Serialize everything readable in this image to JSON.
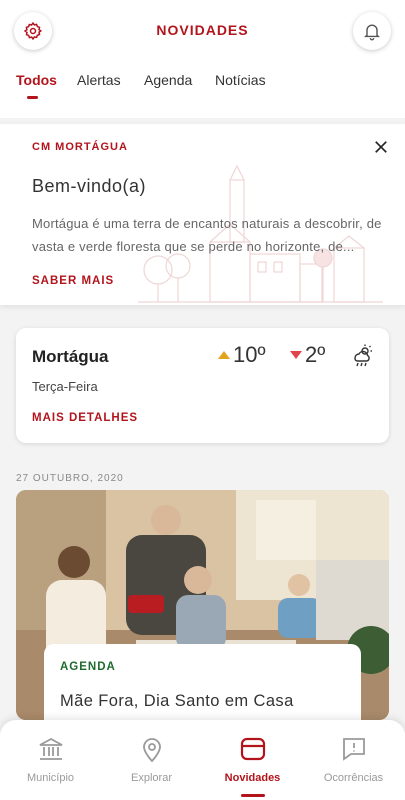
{
  "header": {
    "title": "NOVIDADES",
    "settings_icon": "gear-icon",
    "notifications_icon": "bell-icon"
  },
  "tabs": [
    {
      "label": "Todos",
      "active": true
    },
    {
      "label": "Alertas",
      "active": false
    },
    {
      "label": "Agenda",
      "active": false
    },
    {
      "label": "Notícias",
      "active": false
    }
  ],
  "welcome": {
    "source": "CM MORTÁGUA",
    "title": "Bem-vindo(a)",
    "text": "Mortágua é uma terra de encantos naturais a descobrir, de vasta e verde floresta que se perde no horizonte, de...",
    "link": "SABER MAIS"
  },
  "weather": {
    "city": "Mortágua",
    "day": "Terça-Feira",
    "max": "10º",
    "min": "2º",
    "icon": "rain-sun-icon",
    "link": "MAIS DETALHES"
  },
  "feed": {
    "date": "27 OUTUBRO, 2020",
    "item": {
      "category": "AGENDA",
      "title": "Mãe Fora, Dia Santo em Casa"
    }
  },
  "bottom_nav": [
    {
      "label": "Município",
      "icon": "bank-icon",
      "active": false
    },
    {
      "label": "Explorar",
      "icon": "location-pin-icon",
      "active": false
    },
    {
      "label": "Novidades",
      "icon": "news-icon",
      "active": true
    },
    {
      "label": "Ocorrências",
      "icon": "alert-message-icon",
      "active": false
    }
  ],
  "colors": {
    "accent": "#b3141c",
    "agenda": "#1f6b2e",
    "temp_max": "#e2a31a",
    "temp_min": "#e0454c"
  }
}
